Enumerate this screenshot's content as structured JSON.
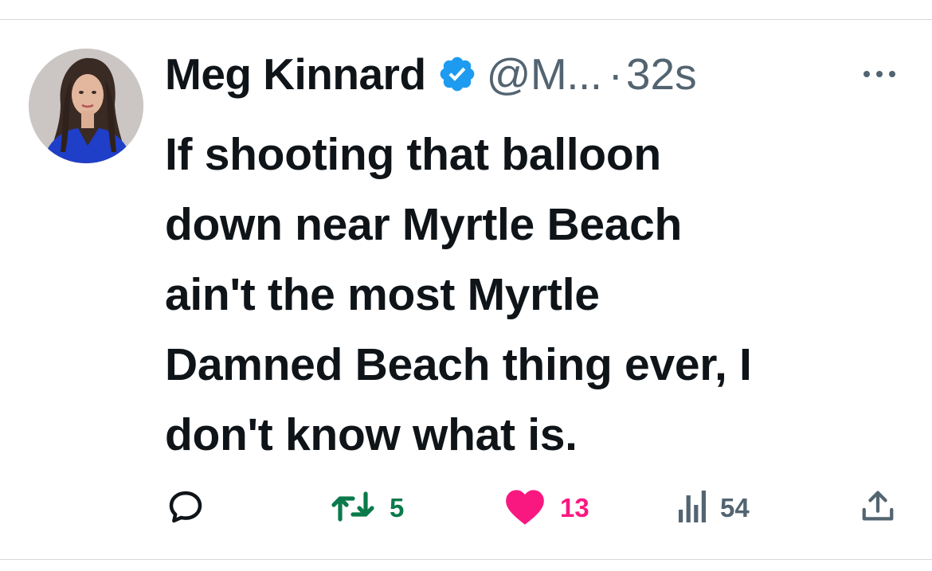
{
  "tweet": {
    "author_name": "Meg Kinnard",
    "handle": "@M...",
    "separator": "·",
    "timestamp": "32s",
    "text": "If shooting that balloon\ndown near Myrtle Beach\nain't the most Myrtle\nDamned Beach thing ever, I\ndon't know what is.",
    "verified": true
  },
  "actions": {
    "reply_icon": "comment-icon",
    "retweet_icon": "retweet-icon",
    "retweet_count": "5",
    "like_icon": "heart-icon",
    "like_count": "13",
    "views_icon": "analytics-icon",
    "views_count": "54",
    "share_icon": "share-icon"
  },
  "colors": {
    "text_primary": "#0f1419",
    "text_secondary": "#536471",
    "verified_blue": "#1d9bf0",
    "retweet_green": "#0b7a4b",
    "like_pink": "#f91880"
  }
}
